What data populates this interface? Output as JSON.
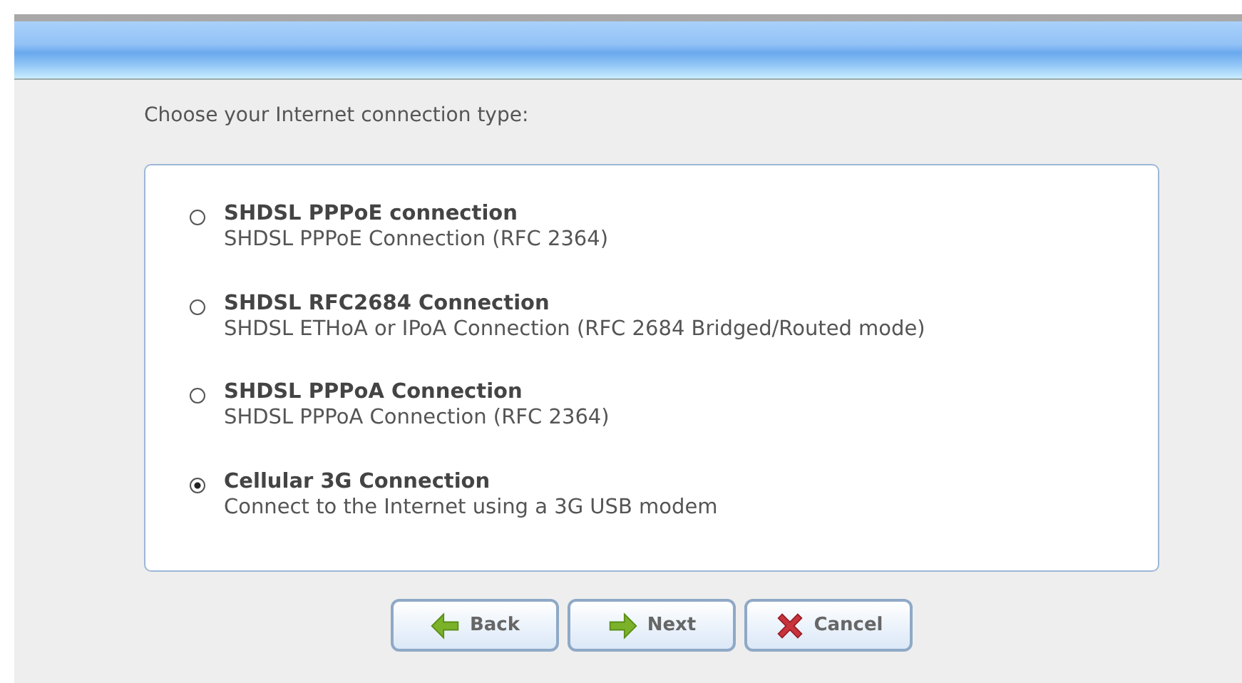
{
  "prompt": "Choose your Internet connection type:",
  "options": [
    {
      "title": "SHDSL PPPoE connection",
      "description": "SHDSL PPPoE Connection (RFC 2364)",
      "selected": false
    },
    {
      "title": "SHDSL RFC2684 Connection",
      "description": "SHDSL ETHoA or IPoA Connection (RFC 2684 Bridged/Routed mode)",
      "selected": false
    },
    {
      "title": "SHDSL PPPoA Connection",
      "description": "SHDSL PPPoA Connection (RFC 2364)",
      "selected": false
    },
    {
      "title": "Cellular 3G Connection",
      "description": "Connect to the Internet using a 3G USB modem",
      "selected": true
    }
  ],
  "buttons": [
    {
      "kind": "back",
      "label": "Back"
    },
    {
      "kind": "next",
      "label": "Next"
    },
    {
      "kind": "cancel",
      "label": "Cancel"
    }
  ]
}
